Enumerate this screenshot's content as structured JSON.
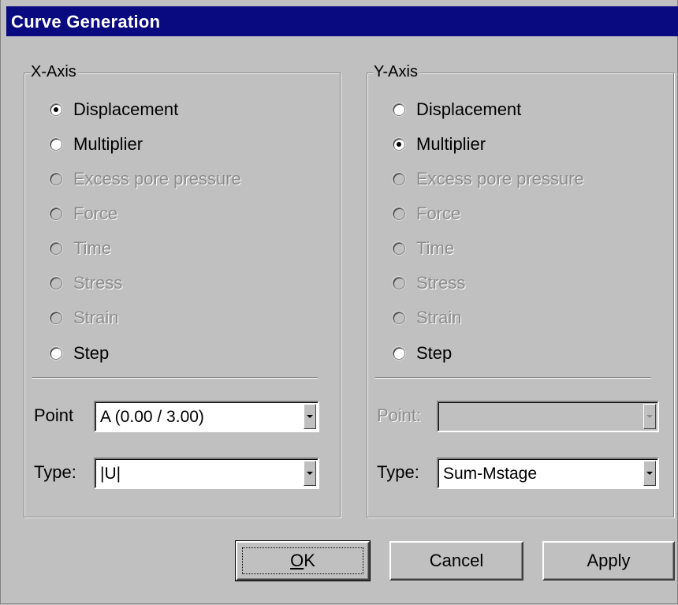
{
  "window": {
    "title": "Curve Generation"
  },
  "x_axis": {
    "label": "X-Axis",
    "options": [
      {
        "label": "Displacement",
        "checked": true,
        "enabled": true
      },
      {
        "label": "Multiplier",
        "checked": false,
        "enabled": true
      },
      {
        "label": "Excess pore pressure",
        "checked": false,
        "enabled": false
      },
      {
        "label": "Force",
        "checked": false,
        "enabled": false
      },
      {
        "label": "Time",
        "checked": false,
        "enabled": false
      },
      {
        "label": "Stress",
        "checked": false,
        "enabled": false
      },
      {
        "label": "Strain",
        "checked": false,
        "enabled": false
      },
      {
        "label": "Step",
        "checked": false,
        "enabled": true
      }
    ],
    "point_label": "Point",
    "point_value": "A (0.00 / 3.00)",
    "type_label": "Type:",
    "type_value": "|U|"
  },
  "y_axis": {
    "label": "Y-Axis",
    "options": [
      {
        "label": "Displacement",
        "checked": false,
        "enabled": true
      },
      {
        "label": "Multiplier",
        "checked": true,
        "enabled": true
      },
      {
        "label": "Excess pore pressure",
        "checked": false,
        "enabled": false
      },
      {
        "label": "Force",
        "checked": false,
        "enabled": false
      },
      {
        "label": "Time",
        "checked": false,
        "enabled": false
      },
      {
        "label": "Stress",
        "checked": false,
        "enabled": false
      },
      {
        "label": "Strain",
        "checked": false,
        "enabled": false
      },
      {
        "label": "Step",
        "checked": false,
        "enabled": true
      }
    ],
    "point_label": "Point:",
    "point_value": "",
    "type_label": "Type:",
    "type_value": "Sum-Mstage"
  },
  "buttons": {
    "ok_mnemonic": "O",
    "ok_rest": "K",
    "cancel": "Cancel",
    "apply": "Apply"
  }
}
